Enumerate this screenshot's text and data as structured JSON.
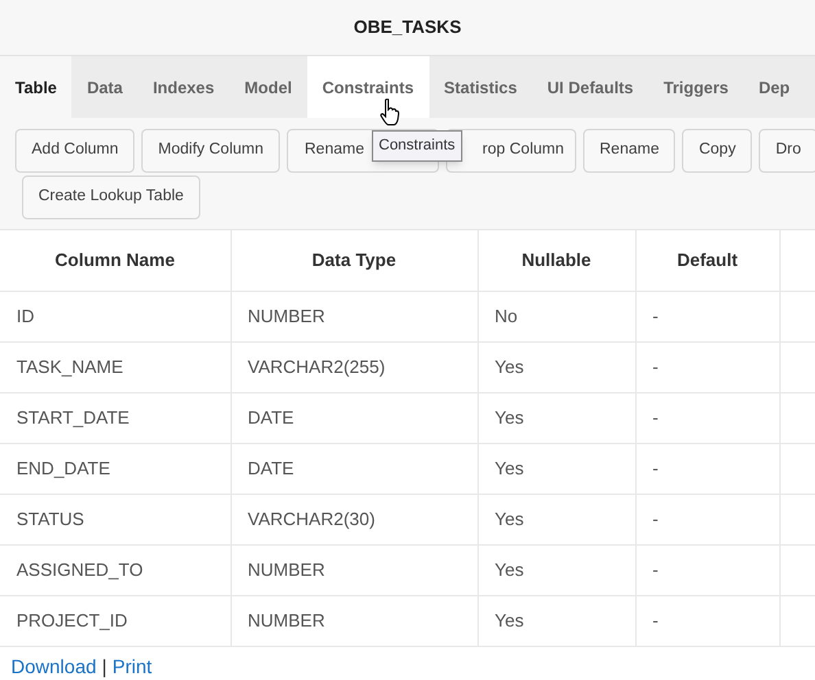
{
  "title": "OBE_TASKS",
  "tabs": [
    {
      "label": "Table",
      "selected": true,
      "hovered": false
    },
    {
      "label": "Data",
      "selected": false,
      "hovered": false
    },
    {
      "label": "Indexes",
      "selected": false,
      "hovered": false
    },
    {
      "label": "Model",
      "selected": false,
      "hovered": false
    },
    {
      "label": "Constraints",
      "selected": false,
      "hovered": true
    },
    {
      "label": "Statistics",
      "selected": false,
      "hovered": false
    },
    {
      "label": "UI Defaults",
      "selected": false,
      "hovered": false
    },
    {
      "label": "Triggers",
      "selected": false,
      "hovered": false
    },
    {
      "label": "Dep",
      "selected": false,
      "hovered": false
    }
  ],
  "tooltip": "Constraints",
  "buttons": [
    "Add Column",
    "Modify Column",
    "Rename",
    "rop Column",
    "Rename",
    "Copy",
    "Dro",
    "Create Lookup Table"
  ],
  "table": {
    "columns": [
      "Column Name",
      "Data Type",
      "Nullable",
      "Default"
    ],
    "rows": [
      [
        "ID",
        "NUMBER",
        "No",
        "-"
      ],
      [
        "TASK_NAME",
        "VARCHAR2(255)",
        "Yes",
        "-"
      ],
      [
        "START_DATE",
        "DATE",
        "Yes",
        "-"
      ],
      [
        "END_DATE",
        "DATE",
        "Yes",
        "-"
      ],
      [
        "STATUS",
        "VARCHAR2(30)",
        "Yes",
        "-"
      ],
      [
        "ASSIGNED_TO",
        "NUMBER",
        "Yes",
        "-"
      ],
      [
        "PROJECT_ID",
        "NUMBER",
        "Yes",
        "-"
      ]
    ]
  },
  "links": [
    "Download",
    "Print"
  ],
  "link_separator": "|"
}
